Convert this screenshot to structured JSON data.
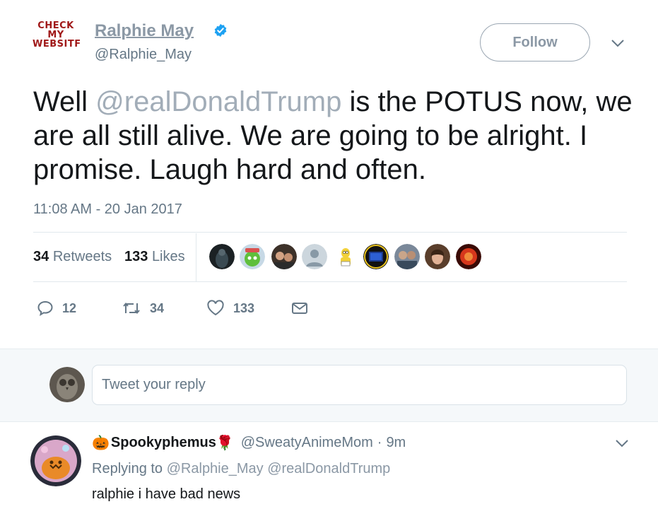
{
  "tweet": {
    "avatar_text": [
      "CHECK",
      "MY",
      "WEBSITF"
    ],
    "display_name": "Ralphie May",
    "handle": "@Ralphie_May",
    "follow_label": "Follow",
    "text_before": "Well ",
    "mention": "@realDonaldTrump",
    "text_after": " is the POTUS now, we are all still alive. We are going to be alright. I promise. Laugh hard and often.",
    "timestamp": "11:08 AM - 20 Jan 2017",
    "stats": {
      "retweets_count": "34",
      "retweets_label": "Retweets",
      "likes_count": "133",
      "likes_label": "Likes"
    },
    "actions": {
      "replies": "12",
      "retweets": "34",
      "likes": "133"
    }
  },
  "reply_composer": {
    "placeholder": "Tweet your reply"
  },
  "reply": {
    "name_prefix_emoji": "🎃",
    "name": "Spookyphemus",
    "name_suffix_emoji": "🌹",
    "handle": "@SweatyAnimeMom",
    "separator": "·",
    "time": "9m",
    "replying_label": "Replying to",
    "replying_to": "@Ralphie_May @realDonaldTrump",
    "text": "ralphie i have bad news"
  },
  "icons": [
    "verified-badge-icon",
    "chevron-down-icon",
    "reply-icon",
    "retweet-icon",
    "heart-icon",
    "message-icon"
  ],
  "colors": {
    "verified_blue": "#1da1f2",
    "muted": "#657786",
    "text": "#14171a",
    "avatar_text_red": "#a01818"
  }
}
